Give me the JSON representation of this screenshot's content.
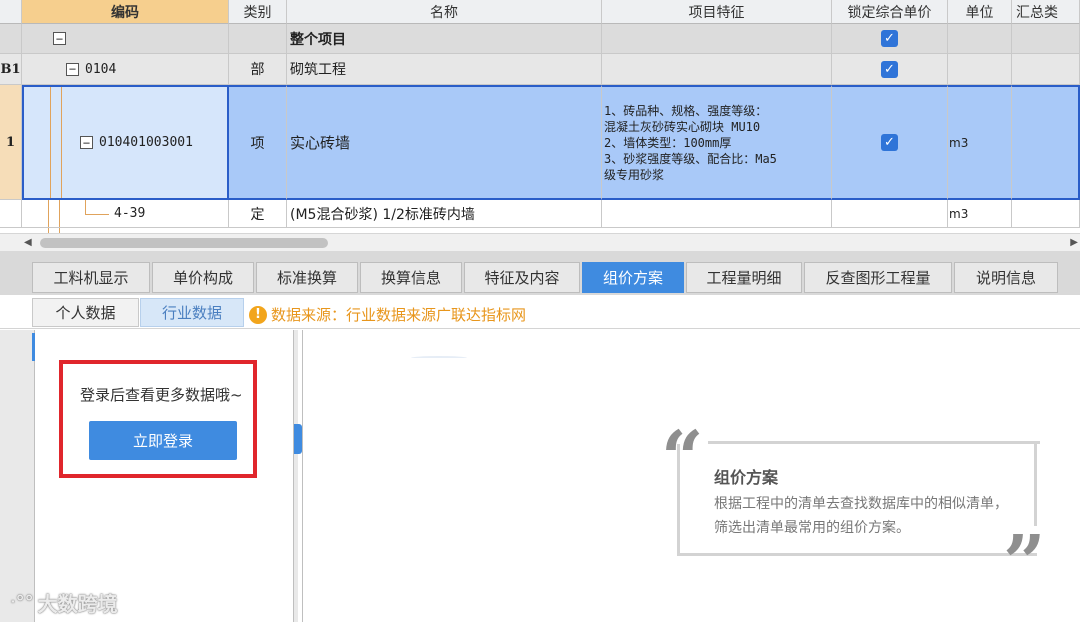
{
  "grid": {
    "headers": [
      "",
      "编码",
      "类别",
      "名称",
      "项目特征",
      "锁定综合单价",
      "单位",
      "汇总类"
    ],
    "rows": [
      {
        "row_no": "",
        "code": "",
        "category": "",
        "name": "整个项目",
        "feature": [],
        "locked": true,
        "unit": ""
      },
      {
        "row_no": "B1",
        "code": "0104",
        "category": "部",
        "name": "砌筑工程",
        "feature": [],
        "locked": true,
        "unit": ""
      },
      {
        "row_no": "1",
        "code": "010401003001",
        "category": "项",
        "name": "实心砖墙",
        "feature": [
          "1、砖品种、规格、强度等级：",
          "混凝土灰砂砖实心砌块 MU10",
          "2、墙体类型：100mm厚",
          "3、砂浆强度等级、配合比：Ma5",
          "级专用砂浆"
        ],
        "locked": true,
        "unit": "m3"
      },
      {
        "row_no": "",
        "code": "4-39",
        "category": "定",
        "name": "(M5混合砂浆) 1/2标准砖内墙",
        "feature": [],
        "locked": false,
        "unit": "m3"
      }
    ]
  },
  "tabs": [
    "工料机显示",
    "单价构成",
    "标准换算",
    "换算信息",
    "特征及内容",
    "组价方案",
    "工程量明细",
    "反查图形工程量",
    "说明信息"
  ],
  "active_tab": "组价方案",
  "subtabs": [
    "个人数据",
    "行业数据"
  ],
  "active_subtab": "行业数据",
  "data_source": "数据来源：行业数据来源广联达指标网",
  "login": {
    "message": "登录后查看更多数据哦~",
    "button": "立即登录"
  },
  "info": {
    "title": "组价方案",
    "description": "根据工程中的清单去查找数据库中的相似清单，筛选出清单最常用的组价方案。"
  },
  "watermark": "大数跨境",
  "colors": {
    "accent": "#3f8be0",
    "selected_row": "#a9c9f8",
    "highlight_box": "#e0262c",
    "warning": "#e8961c"
  }
}
